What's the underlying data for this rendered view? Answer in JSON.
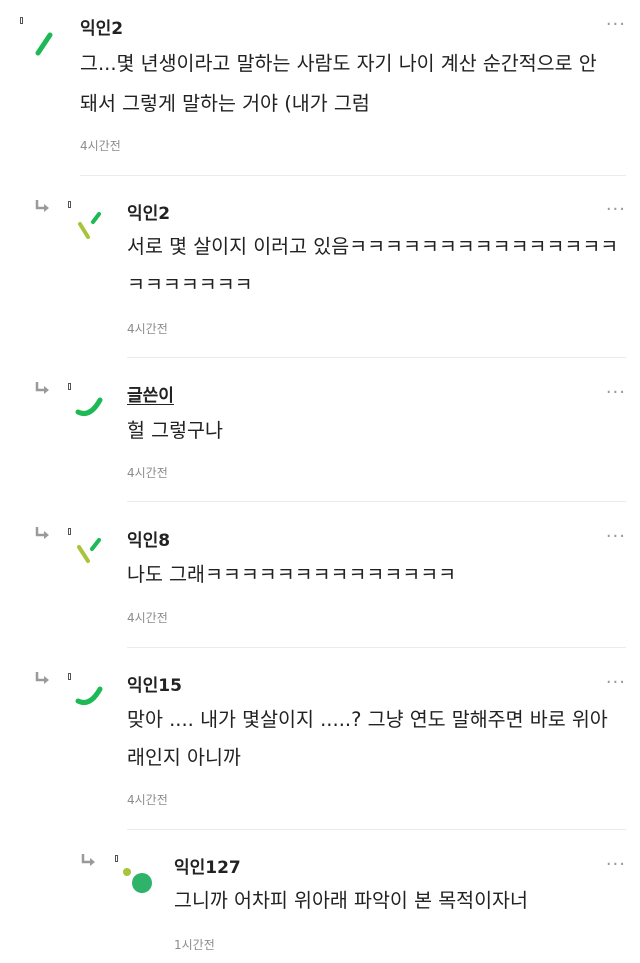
{
  "more_label": "···",
  "comments": [
    {
      "author": "익인2",
      "lines": [
        "그...몇 년생이라고 말하는 사람도 자기 나이 계산 순간적으로 안",
        "돼서 그렇게 말하는 거야 (내가 그럼"
      ],
      "time": "4시간전"
    },
    {
      "author": "익인2",
      "lines": [
        "서로 몇 살이지 이러고 있음ㅋㅋㅋㅋㅋㅋㅋㅋㅋㅋㅋㅋㅋㅋㅋ",
        "ㅋㅋㅋㅋㅋㅋㅋ"
      ],
      "time": "4시간전"
    },
    {
      "author": "글쓴이",
      "lines": [
        "헐 그렇구나"
      ],
      "time": "4시간전"
    },
    {
      "author": "익인8",
      "lines": [
        "나도 그래ㅋㅋㅋㅋㅋㅋㅋㅋㅋㅋㅋㅋㅋㅋ"
      ],
      "time": "4시간전"
    },
    {
      "author": "익인15",
      "lines": [
        "맞아 .... 내가 몇살이지 .....? 그냥 연도 말해주면 바로 위아",
        "래인지 아니까"
      ],
      "time": "4시간전"
    },
    {
      "author": "익인127",
      "lines": [
        "그니까 어차피 위아래 파악이 본 목적이자너"
      ],
      "time": "1시간전"
    }
  ],
  "colors": {
    "green": "#1db954",
    "lime": "#a8c43a",
    "text": "#222222",
    "meta": "#8c8c8c"
  }
}
